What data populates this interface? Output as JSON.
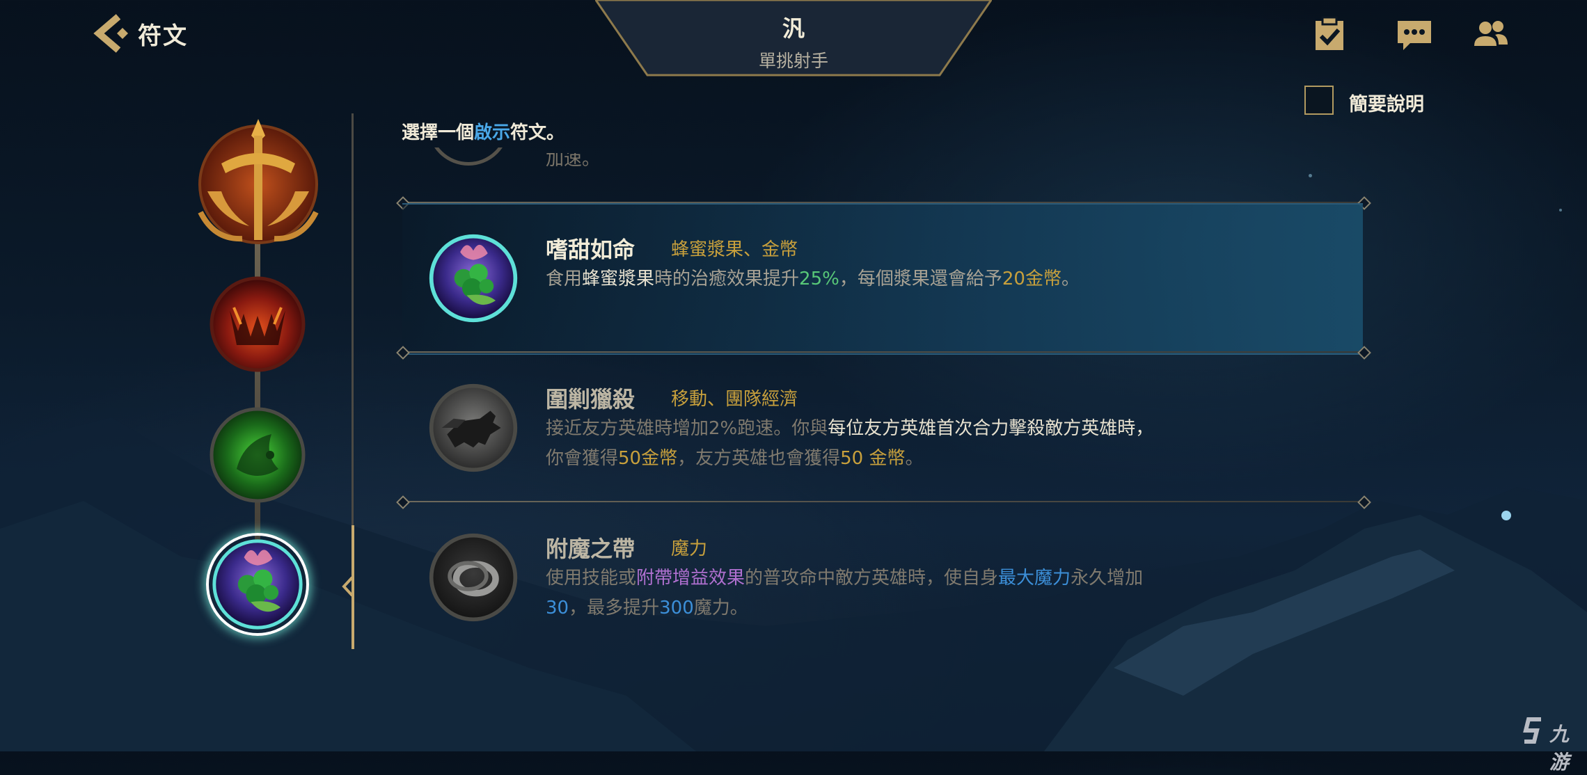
{
  "header": {
    "title": "符文",
    "champion_name": "汎",
    "champion_role": "單挑射手",
    "brief_label": "簡要說明"
  },
  "prompt": {
    "prefix": "選擇一個",
    "highlight": "啟示",
    "suffix": "符文。"
  },
  "clipped_row": {
    "desc_fragment": "加速。"
  },
  "runes": [
    {
      "name": "嗜甜如命",
      "tags": "蜂蜜漿果、金幣",
      "desc": [
        {
          "t": "食用",
          "c": "plain"
        },
        {
          "t": "蜂蜜漿果",
          "c": "white"
        },
        {
          "t": "時的治癒效果提升",
          "c": "plain"
        },
        {
          "t": "25%",
          "c": "green"
        },
        {
          "t": "，每個漿果還會給予",
          "c": "plain"
        },
        {
          "t": "20金幣",
          "c": "gold"
        },
        {
          "t": "。",
          "c": "plain"
        }
      ],
      "selected": true
    },
    {
      "name": "圍剿獵殺",
      "tags": "移動、團隊經濟",
      "desc": [
        {
          "t": "接近友方英雄時增加2%跑速。你與",
          "c": "plain"
        },
        {
          "t": "每位友方英雄首次合力擊殺敵方英雄時，",
          "c": "white"
        },
        {
          "t": "\n",
          "c": "br"
        },
        {
          "t": "你會獲得",
          "c": "plain"
        },
        {
          "t": "50金幣",
          "c": "gold"
        },
        {
          "t": "，友方英雄也會獲得",
          "c": "plain"
        },
        {
          "t": "50 金幣",
          "c": "gold"
        },
        {
          "t": "。",
          "c": "plain"
        }
      ],
      "selected": false
    },
    {
      "name": "附魔之帶",
      "tags": "魔力",
      "desc": [
        {
          "t": "使用技能或",
          "c": "plain"
        },
        {
          "t": "附帶增益效果",
          "c": "purple"
        },
        {
          "t": "的普攻命中敵方英雄時，使自身",
          "c": "plain"
        },
        {
          "t": "最大魔力",
          "c": "blue"
        },
        {
          "t": "永久增加",
          "c": "plain"
        },
        {
          "t": "\n",
          "c": "br"
        },
        {
          "t": "30",
          "c": "blue"
        },
        {
          "t": "，最多提升",
          "c": "plain"
        },
        {
          "t": "300",
          "c": "blue"
        },
        {
          "t": "魔力。",
          "c": "plain"
        }
      ],
      "selected": false
    }
  ],
  "watermark": "九游",
  "colors": {
    "gold_accent": "#c8aa6e",
    "tag_gold": "#c8a03c",
    "highlight_blue": "#4aa8e8",
    "selected_row": "#1a4e6c",
    "mana_blue": "#3c8fd8",
    "buff_purple": "#b070d0",
    "heal_green": "#58c878"
  },
  "icons": [
    "back-chevron-icon",
    "checklist-icon",
    "chat-icon",
    "friends-icon"
  ]
}
